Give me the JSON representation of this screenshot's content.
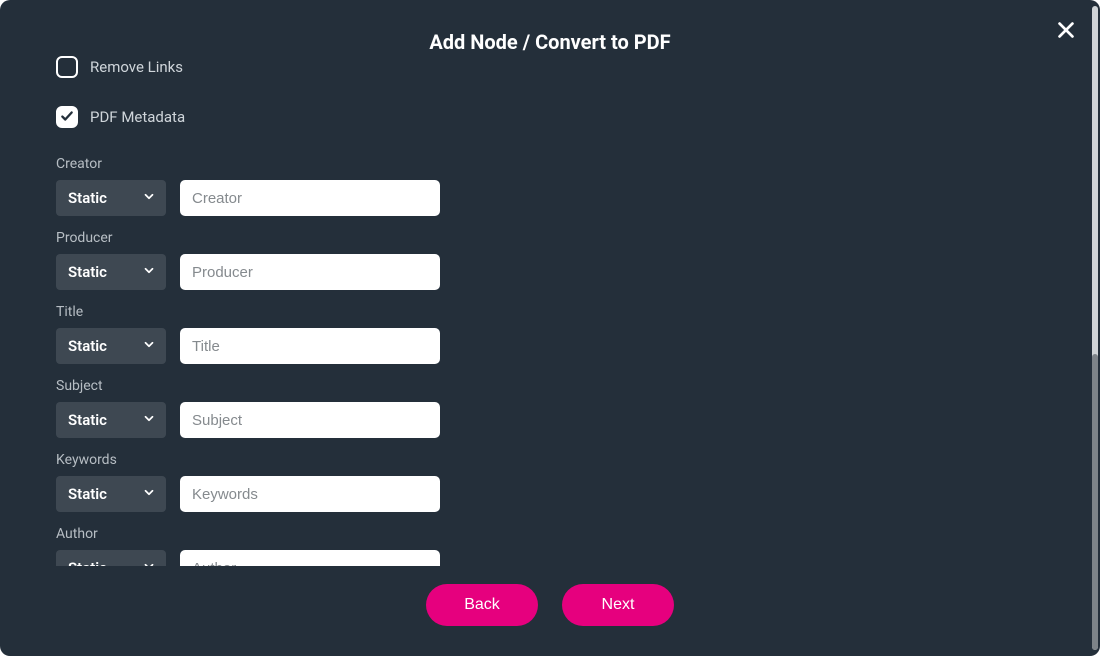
{
  "modal": {
    "title": "Add Node / Convert to PDF"
  },
  "checks": {
    "remove_links": {
      "label": "Remove Links",
      "checked": false
    },
    "pdf_metadata": {
      "label": "PDF Metadata",
      "checked": true
    }
  },
  "select_common": {
    "value": "Static"
  },
  "fields": {
    "creator": {
      "label": "Creator",
      "placeholder": "Creator",
      "value": ""
    },
    "producer": {
      "label": "Producer",
      "placeholder": "Producer",
      "value": ""
    },
    "title": {
      "label": "Title",
      "placeholder": "Title",
      "value": ""
    },
    "subject": {
      "label": "Subject",
      "placeholder": "Subject",
      "value": ""
    },
    "keywords": {
      "label": "Keywords",
      "placeholder": "Keywords",
      "value": ""
    },
    "author": {
      "label": "Author",
      "placeholder": "Author",
      "value": ""
    }
  },
  "buttons": {
    "back": "Back",
    "next": "Next"
  },
  "colors": {
    "accent": "#e6007e",
    "bg": "#242f3a",
    "select_bg": "#3e4852"
  }
}
